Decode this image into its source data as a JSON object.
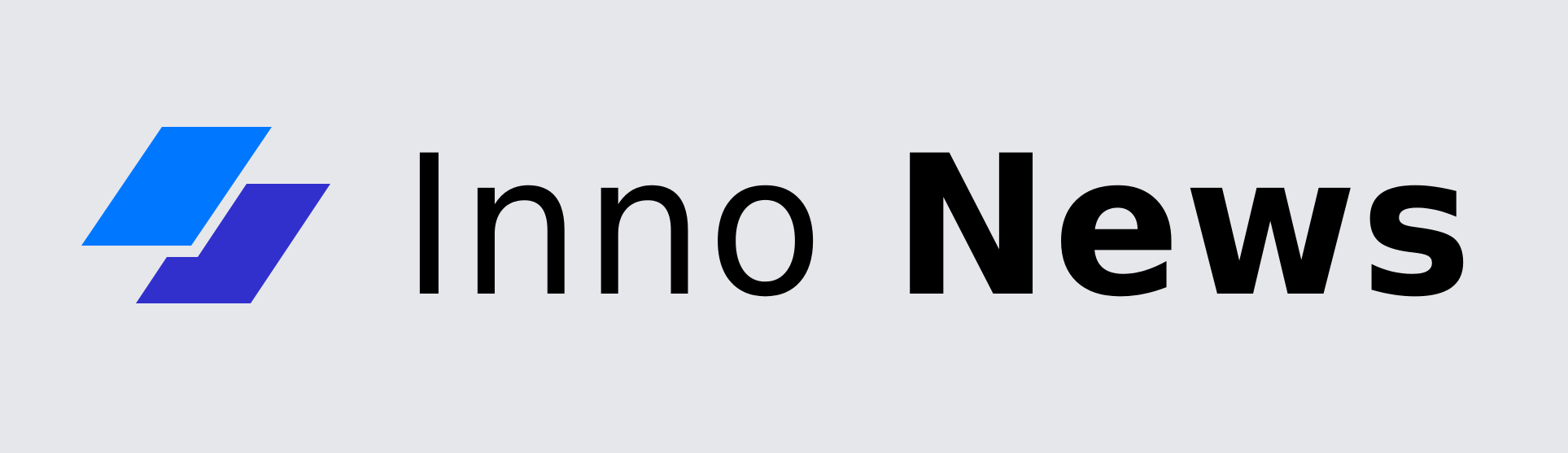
{
  "brand": {
    "name_part1": "Inno",
    "name_part2": "News",
    "colors": {
      "background": "#e6e7eb",
      "text": "#000000",
      "shape_top": "#0077ff",
      "shape_bottom": "#3230cc"
    },
    "logo_icon": "stacked-parallelograms-icon"
  }
}
